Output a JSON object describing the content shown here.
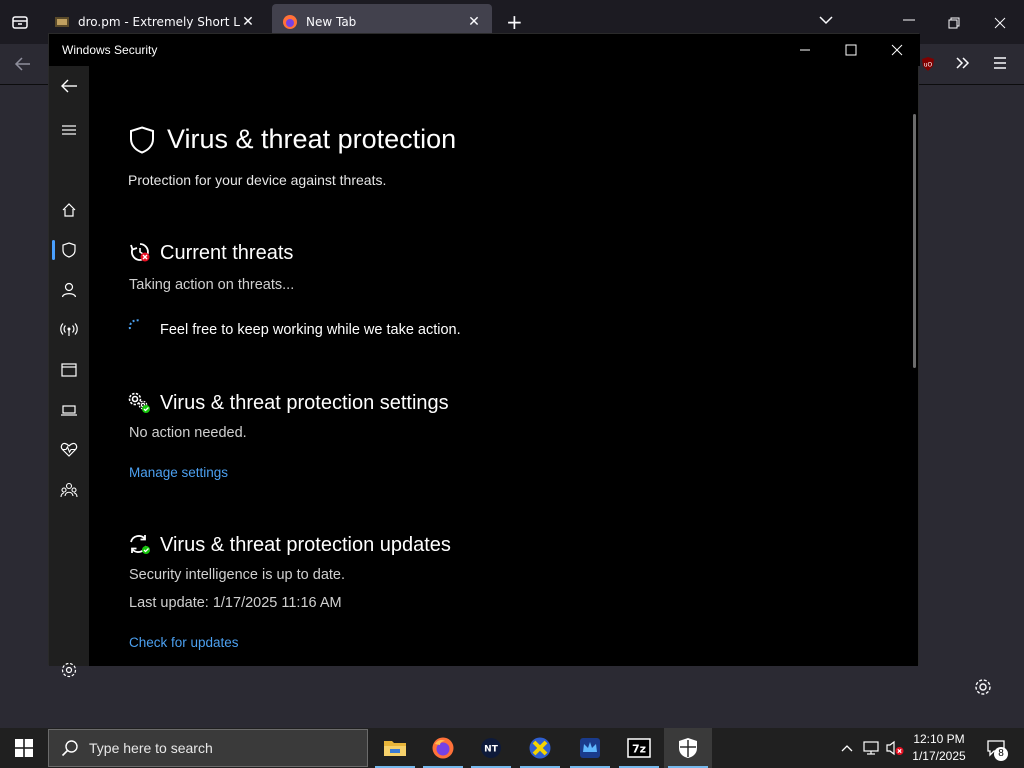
{
  "browser": {
    "tabs": [
      {
        "title": "dro.pm - Extremely Short Links"
      },
      {
        "title": "New Tab"
      }
    ]
  },
  "window": {
    "title": "Windows Security",
    "page_title": "Virus & threat protection",
    "page_subtitle": "Protection for your device against threats.",
    "current_threats": {
      "heading": "Current threats",
      "status": "Taking action on threats...",
      "progress_message": "Feel free to keep working while we take action."
    },
    "settings": {
      "heading": "Virus & threat protection settings",
      "status": "No action needed.",
      "link": "Manage settings"
    },
    "updates": {
      "heading": "Virus & threat protection updates",
      "status": "Security intelligence is up to date.",
      "last_update": "Last update: 1/17/2025 11:16 AM",
      "link": "Check for updates"
    }
  },
  "taskbar": {
    "search_placeholder": "Type here to search",
    "clock_time": "12:10 PM",
    "clock_date": "1/17/2025",
    "notification_count": "8"
  },
  "colors": {
    "accent": "#4ca0f0",
    "window_bg": "#000000",
    "sidebar_bg": "#1f1f1f"
  }
}
